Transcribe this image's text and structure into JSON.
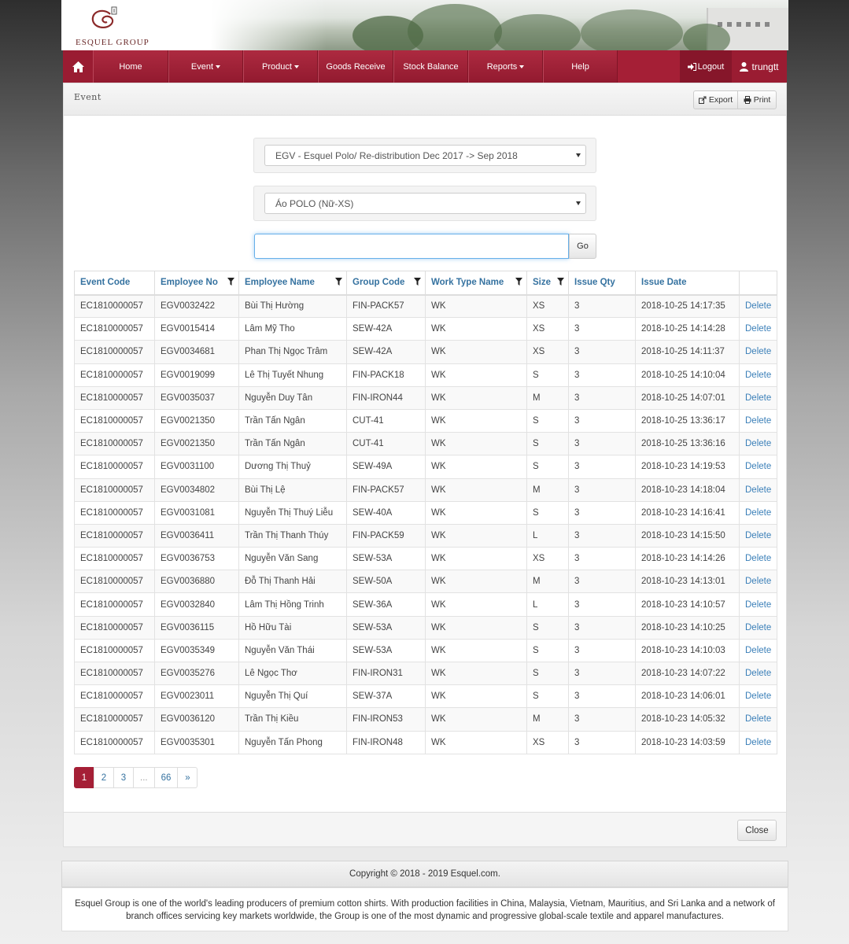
{
  "brand": {
    "logo_text": "ESQUEL GROUP",
    "accent": "#a51f36"
  },
  "nav": {
    "home_icon": "home-icon",
    "items": [
      {
        "label": "Home"
      },
      {
        "label": "Event",
        "dropdown": true
      },
      {
        "label": "Product",
        "dropdown": true
      },
      {
        "label": "Goods Receive"
      },
      {
        "label": "Stock Balance"
      },
      {
        "label": "Reports",
        "dropdown": true
      },
      {
        "label": "Help"
      }
    ],
    "logout_label": "Logout",
    "user_label": "trungtt"
  },
  "panel": {
    "title": "Event",
    "export_label": "Export",
    "print_label": "Print",
    "event_select": "EGV - Esquel Polo/ Re-distribution Dec 2017 -> Sep 2018",
    "product_select": "Áo POLO (Nữ-XS)",
    "search_value": "",
    "go_label": "Go",
    "close_label": "Close"
  },
  "table": {
    "columns": [
      {
        "label": "Event Code",
        "filter": false
      },
      {
        "label": "Employee No",
        "filter": true
      },
      {
        "label": "Employee Name",
        "filter": true
      },
      {
        "label": "Group Code",
        "filter": true
      },
      {
        "label": "Work Type Name",
        "filter": true
      },
      {
        "label": "Size",
        "filter": true
      },
      {
        "label": "Issue Qty",
        "filter": false
      },
      {
        "label": "Issue Date",
        "filter": false
      },
      {
        "label": "",
        "filter": false
      }
    ],
    "rows": [
      [
        "EC1810000057",
        "EGV0032422",
        "Bùi Thị Hường",
        "FIN-PACK57",
        "WK",
        "XS",
        "3",
        "2018-10-25 14:17:35",
        "Delete"
      ],
      [
        "EC1810000057",
        "EGV0015414",
        "Lâm Mỹ Tho",
        "SEW-42A",
        "WK",
        "XS",
        "3",
        "2018-10-25 14:14:28",
        "Delete"
      ],
      [
        "EC1810000057",
        "EGV0034681",
        "Phan Thị Ngọc Trâm",
        "SEW-42A",
        "WK",
        "XS",
        "3",
        "2018-10-25 14:11:37",
        "Delete"
      ],
      [
        "EC1810000057",
        "EGV0019099",
        "Lê Thị Tuyết Nhung",
        "FIN-PACK18",
        "WK",
        "S",
        "3",
        "2018-10-25 14:10:04",
        "Delete"
      ],
      [
        "EC1810000057",
        "EGV0035037",
        "Nguyễn Duy Tân",
        "FIN-IRON44",
        "WK",
        "M",
        "3",
        "2018-10-25 14:07:01",
        "Delete"
      ],
      [
        "EC1810000057",
        "EGV0021350",
        "Trần Tấn Ngân",
        "CUT-41",
        "WK",
        "S",
        "3",
        "2018-10-25 13:36:17",
        "Delete"
      ],
      [
        "EC1810000057",
        "EGV0021350",
        "Trần Tấn Ngân",
        "CUT-41",
        "WK",
        "S",
        "3",
        "2018-10-25 13:36:16",
        "Delete"
      ],
      [
        "EC1810000057",
        "EGV0031100",
        "Dương Thị Thuỷ",
        "SEW-49A",
        "WK",
        "S",
        "3",
        "2018-10-23 14:19:53",
        "Delete"
      ],
      [
        "EC1810000057",
        "EGV0034802",
        "Bùi Thị Lệ",
        "FIN-PACK57",
        "WK",
        "M",
        "3",
        "2018-10-23 14:18:04",
        "Delete"
      ],
      [
        "EC1810000057",
        "EGV0031081",
        "Nguyễn Thị Thuý Liễu",
        "SEW-40A",
        "WK",
        "S",
        "3",
        "2018-10-23 14:16:41",
        "Delete"
      ],
      [
        "EC1810000057",
        "EGV0036411",
        "Trần Thị Thanh Thúy",
        "FIN-PACK59",
        "WK",
        "L",
        "3",
        "2018-10-23 14:15:50",
        "Delete"
      ],
      [
        "EC1810000057",
        "EGV0036753",
        "Nguyễn Văn Sang",
        "SEW-53A",
        "WK",
        "XS",
        "3",
        "2018-10-23 14:14:26",
        "Delete"
      ],
      [
        "EC1810000057",
        "EGV0036880",
        "Đỗ Thị Thanh Hải",
        "SEW-50A",
        "WK",
        "M",
        "3",
        "2018-10-23 14:13:01",
        "Delete"
      ],
      [
        "EC1810000057",
        "EGV0032840",
        "Lâm Thị Hồng Trinh",
        "SEW-36A",
        "WK",
        "L",
        "3",
        "2018-10-23 14:10:57",
        "Delete"
      ],
      [
        "EC1810000057",
        "EGV0036115",
        "Hồ Hữu Tài",
        "SEW-53A",
        "WK",
        "S",
        "3",
        "2018-10-23 14:10:25",
        "Delete"
      ],
      [
        "EC1810000057",
        "EGV0035349",
        "Nguyễn Văn Thái",
        "SEW-53A",
        "WK",
        "S",
        "3",
        "2018-10-23 14:10:03",
        "Delete"
      ],
      [
        "EC1810000057",
        "EGV0035276",
        "Lê Ngọc Thơ",
        "FIN-IRON31",
        "WK",
        "S",
        "3",
        "2018-10-23 14:07:22",
        "Delete"
      ],
      [
        "EC1810000057",
        "EGV0023011",
        "Nguyễn Thị Quí",
        "SEW-37A",
        "WK",
        "S",
        "3",
        "2018-10-23 14:06:01",
        "Delete"
      ],
      [
        "EC1810000057",
        "EGV0036120",
        "Trần Thị Kiều",
        "FIN-IRON53",
        "WK",
        "M",
        "3",
        "2018-10-23 14:05:32",
        "Delete"
      ],
      [
        "EC1810000057",
        "EGV0035301",
        "Nguyễn Tấn Phong",
        "FIN-IRON48",
        "WK",
        "XS",
        "3",
        "2018-10-23 14:03:59",
        "Delete"
      ]
    ]
  },
  "pagination": {
    "pages": [
      "1",
      "2",
      "3",
      "...",
      "66",
      "»"
    ],
    "active": "1"
  },
  "footer": {
    "copyright": "Copyright © 2018 - 2019 Esquel.com.",
    "about": "Esquel Group is one of the world's leading producers of premium cotton shirts. With production facilities in China, Malaysia, Vietnam, Mauritius, and Sri Lanka and a network of branch offices servicing key markets worldwide, the Group is one of the most dynamic and progressive global-scale textile and apparel manufactures."
  }
}
